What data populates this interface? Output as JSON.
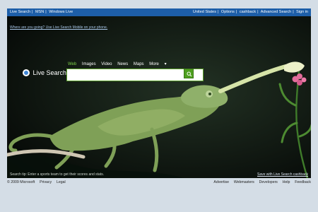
{
  "top_nav_left": [
    "Live Search",
    "MSN",
    "Windows Live"
  ],
  "top_nav_right": [
    "United States",
    "Options",
    "cashback",
    "Advanced Search",
    "Sign in"
  ],
  "where_message": "Where are you going? Use Live Search Mobile on your phone.",
  "logo_text": "Live Search",
  "tabs": [
    "Web",
    "Images",
    "Video",
    "News",
    "Maps",
    "More"
  ],
  "search": {
    "value": "",
    "placeholder": ""
  },
  "tip_text": "Search tip: Enter a sports team to get their scores and stats.",
  "save_bg_text": "Save with Live Search cashback",
  "footer_left": [
    "© 2009 Microsoft",
    "Privacy",
    "Legal"
  ],
  "footer_right": [
    "Advertise",
    "Webmasters",
    "Developers",
    "Help",
    "Feedback"
  ],
  "colors": {
    "brand_blue": "#1d5ea8",
    "accent_green": "#7fd34a"
  }
}
